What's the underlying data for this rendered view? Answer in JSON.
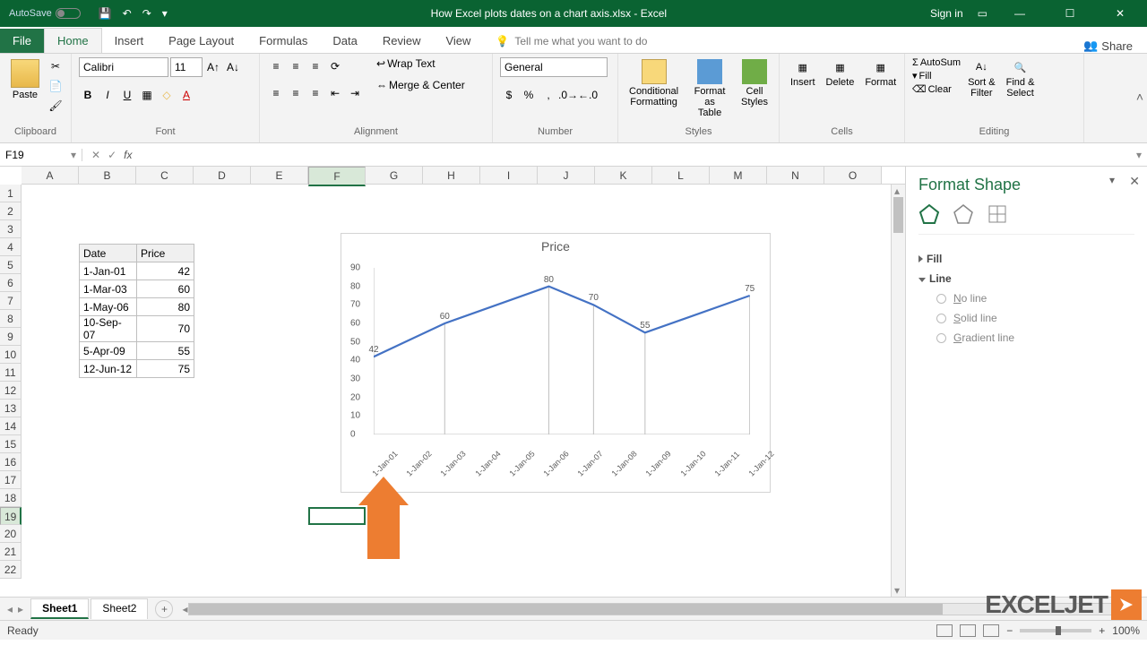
{
  "title": "How Excel plots dates on a chart axis.xlsx - Excel",
  "autosave": "AutoSave",
  "signin": "Sign in",
  "tabs": {
    "file": "File",
    "home": "Home",
    "insert": "Insert",
    "pagelayout": "Page Layout",
    "formulas": "Formulas",
    "data": "Data",
    "review": "Review",
    "view": "View",
    "tell": "Tell me what you want to do",
    "share": "Share"
  },
  "ribbon": {
    "paste": "Paste",
    "fontName": "Calibri",
    "fontSize": "11",
    "wrap": "Wrap Text",
    "merge": "Merge & Center",
    "numberFormat": "General",
    "condfmt": "Conditional\nFormatting",
    "fmttable": "Format as\nTable",
    "cellstyles": "Cell\nStyles",
    "insert": "Insert",
    "delete": "Delete",
    "format": "Format",
    "autosum": "AutoSum",
    "fill": "Fill",
    "clear": "Clear",
    "sortfilter": "Sort &\nFilter",
    "findselect": "Find &\nSelect",
    "groups": {
      "clipboard": "Clipboard",
      "font": "Font",
      "alignment": "Alignment",
      "number": "Number",
      "styles": "Styles",
      "cells": "Cells",
      "editing": "Editing"
    }
  },
  "nameBox": "F19",
  "columns": [
    "A",
    "B",
    "C",
    "D",
    "E",
    "F",
    "G",
    "H",
    "I",
    "J",
    "K",
    "L",
    "M",
    "N",
    "O"
  ],
  "selectedColIndex": 5,
  "selectedRowIndex": 19,
  "table": {
    "headers": [
      "Date",
      "Price"
    ],
    "rows": [
      [
        "1-Jan-01",
        "42"
      ],
      [
        "1-Mar-03",
        "60"
      ],
      [
        "1-May-06",
        "80"
      ],
      [
        "10-Sep-07",
        "70"
      ],
      [
        "5-Apr-09",
        "55"
      ],
      [
        "12-Jun-12",
        "75"
      ]
    ]
  },
  "chart_data": {
    "type": "line",
    "title": "Price",
    "ylim": [
      0,
      90
    ],
    "ystep": 10,
    "x_ticks": [
      "1-Jan-01",
      "1-Jan-02",
      "1-Jan-03",
      "1-Jan-04",
      "1-Jan-05",
      "1-Jan-06",
      "1-Jan-07",
      "1-Jan-08",
      "1-Jan-09",
      "1-Jan-10",
      "1-Jan-11",
      "1-Jan-12"
    ],
    "series": [
      {
        "name": "Price",
        "points": [
          {
            "x": "1-Jan-01",
            "y": 42
          },
          {
            "x": "1-Mar-03",
            "y": 60
          },
          {
            "x": "1-May-06",
            "y": 80
          },
          {
            "x": "10-Sep-07",
            "y": 70
          },
          {
            "x": "5-Apr-09",
            "y": 55
          },
          {
            "x": "12-Jun-12",
            "y": 75
          }
        ]
      }
    ]
  },
  "sheetTabs": [
    "Sheet1",
    "Sheet2"
  ],
  "activeSheet": 0,
  "pane": {
    "title": "Format Shape",
    "fill": "Fill",
    "line": "Line",
    "noline": "No line",
    "solid": "Solid line",
    "gradient": "Gradient line"
  },
  "status": "Ready",
  "zoom": "100%",
  "logo": "EXCELJET"
}
